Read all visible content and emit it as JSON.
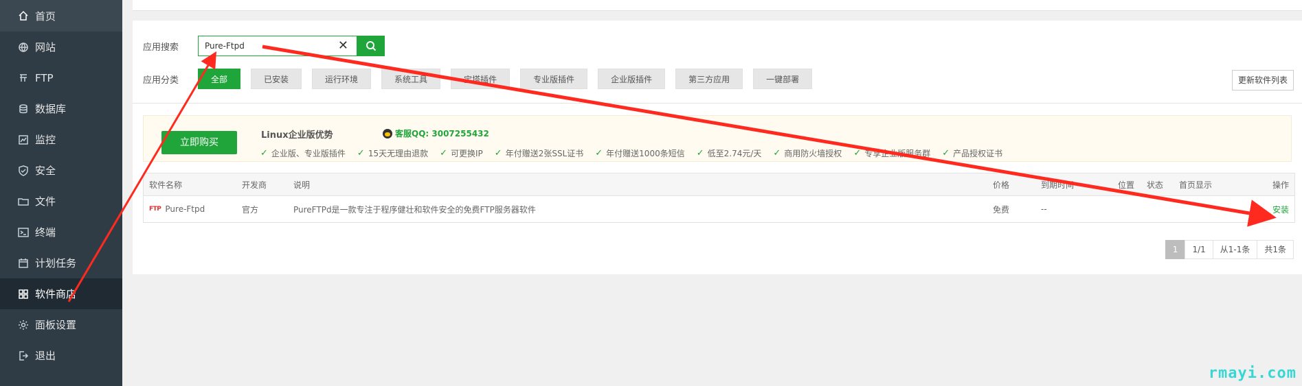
{
  "sidebar": {
    "items": [
      {
        "label": "首页",
        "icon": "home-icon"
      },
      {
        "label": "网站",
        "icon": "globe-icon"
      },
      {
        "label": "FTP",
        "icon": "ftp-icon"
      },
      {
        "label": "数据库",
        "icon": "database-icon"
      },
      {
        "label": "监控",
        "icon": "monitor-icon"
      },
      {
        "label": "安全",
        "icon": "shield-icon"
      },
      {
        "label": "文件",
        "icon": "folder-icon"
      },
      {
        "label": "终端",
        "icon": "terminal-icon"
      },
      {
        "label": "计划任务",
        "icon": "calendar-icon"
      },
      {
        "label": "软件商店",
        "icon": "apps-grid-icon"
      },
      {
        "label": "面板设置",
        "icon": "gear-icon"
      },
      {
        "label": "退出",
        "icon": "logout-icon"
      }
    ],
    "active_index": 9
  },
  "search": {
    "label": "应用搜索",
    "value": "Pure-Ftpd",
    "clear_symbol": "✕"
  },
  "categories": {
    "label": "应用分类",
    "items": [
      "全部",
      "已安装",
      "运行环境",
      "系统工具",
      "宝塔插件",
      "专业版插件",
      "企业版插件",
      "第三方应用",
      "一键部署"
    ],
    "active_index": 0,
    "refresh_label": "更新软件列表"
  },
  "promo": {
    "buy_label": "立即购买",
    "title": "Linux企业版优势",
    "qq": "客服QQ: 3007255432",
    "features": [
      "企业版、专业版插件",
      "15天无理由退款",
      "可更换IP",
      "年付赠送2张SSL证书",
      "年付赠送1000条短信",
      "低至2.74元/天",
      "商用防火墙授权",
      "专享企业版服务群",
      "产品授权证书"
    ]
  },
  "table": {
    "headers": [
      "软件名称",
      "开发商",
      "说明",
      "价格",
      "到期时间",
      "位置",
      "状态",
      "首页显示",
      "操作"
    ],
    "rows": [
      {
        "name": "Pure-Ftpd",
        "logo_text": "FTP",
        "vendor": "官方",
        "desc": "PureFTPd是一款专注于程序健壮和软件安全的免费FTP服务器软件",
        "price": "免费",
        "expire": "--",
        "action": "安装"
      }
    ]
  },
  "pager": {
    "current": "1",
    "pages": "1/1",
    "range": "从1-1条",
    "total": "共1条"
  },
  "watermark": "rmayi.com",
  "colors": {
    "accent": "#20a53a",
    "sidebar_bg": "#2f3c46",
    "annotation": "#ff2a1f"
  }
}
